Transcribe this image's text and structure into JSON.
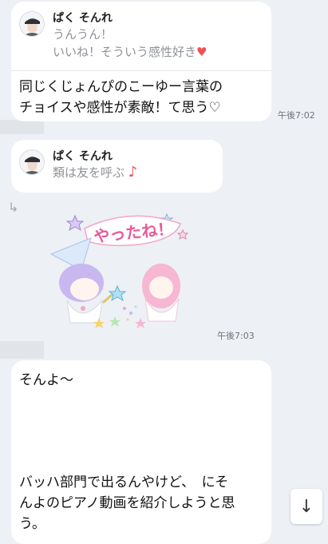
{
  "chat": {
    "msg1": {
      "reply": {
        "name": "ぱく そんれ",
        "line1": "うんうん！",
        "line2": "いいね！そういう感性好き",
        "heart": "♥"
      },
      "text_line1": "同じくじょんぴのこーゆー言葉の",
      "text_line2": "チョイスや感性が素敵！て思う♡",
      "time": "午後7:02"
    },
    "msg2": {
      "reply": {
        "name": "ぱく そんれ",
        "line1": "類は友を呼ぶ",
        "note": "♪"
      },
      "reply_arrow": "↳"
    },
    "sticker": {
      "label": "やったね！",
      "time": "午後7:03"
    },
    "msg3": {
      "line1": "そんよ〜",
      "line2": "バッハ部門で出るんやけど、　にそ",
      "line3": "んよのピアノ動画を紹介しようと思",
      "line4": "う。"
    },
    "scroll_button": {
      "icon": "arrow-down-icon",
      "glyph": "↓"
    }
  },
  "colors": {
    "background": "#edf0f4",
    "bubble": "#ffffff",
    "quote_text": "#8f9398",
    "heart": "#ef4f57",
    "sticker_pink": "#f2a6c8",
    "sticker_lavender": "#c9b8f0"
  }
}
